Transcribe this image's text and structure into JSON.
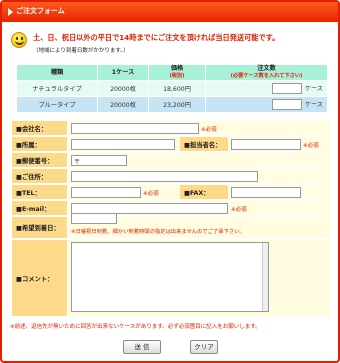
{
  "header": {
    "title": "ご注文フォーム"
  },
  "notice": {
    "main": "土、日、祝日以外の平日で14時までにご注文を頂ければ当日発送可能です。",
    "sub": "（地域により到着日数がかかります。）"
  },
  "product_table": {
    "headers": {
      "type": "種類",
      "per_case": "1ケース",
      "price": "価格",
      "price_note": "(税別)",
      "order": "注文数",
      "order_note": "(必要ケース数を入れて下さい)"
    },
    "rows": [
      {
        "type": "ナチュラルタイプ",
        "per_case": "20000枚",
        "price": "18,600円",
        "unit": "ケース"
      },
      {
        "type": "ブルータイプ",
        "per_case": "20000枚",
        "price": "23,200円",
        "unit": "ケース"
      }
    ]
  },
  "form": {
    "company": "■会社名：",
    "department": "■所属：",
    "contact": "■担当者名：",
    "zip": "■郵便番号：",
    "zip_mark": "〒",
    "address": "■ご住所：",
    "tel": "■TEL：",
    "fax": "■FAX：",
    "email": "■E-mail：",
    "delivery_date": "■希望到着日：",
    "comment": "■コメント：",
    "required": "※必須",
    "delivery_note": "※日曜祝日到着、細かい到着時間の指定は出来ませんのでご了承下さい。"
  },
  "footer": {
    "note": "※前述、返信先が無いために回答が出来ないケースがあります。必ず必須箇目に記入をお願いします。",
    "submit_label": "送 信",
    "clear_label": "クリア"
  }
}
